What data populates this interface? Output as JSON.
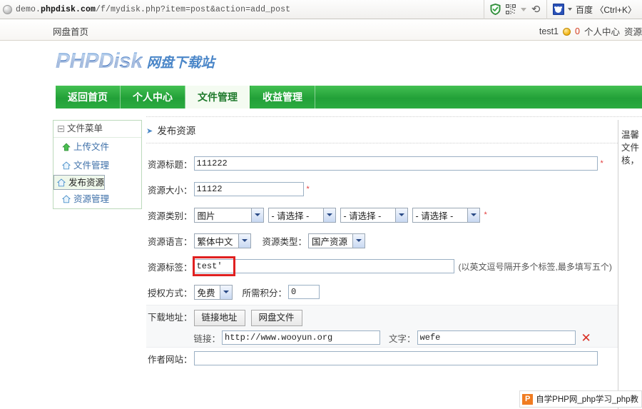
{
  "browser": {
    "url_prefix": "demo.",
    "url_bold": "phpdisk.com",
    "url_suffix": "/f/mydisk.php?item=post&action=add_post",
    "shield_icon": "shield-check-icon",
    "qr_icon": "qr-code-icon",
    "dropdown_icon": "chevron-down-icon",
    "reload_icon": "reload-icon",
    "search_engine_icon": "baidu-paw-icon",
    "search_label": "百度 〈Ctrl+K〉"
  },
  "topbar": {
    "home_link": "网盘首页",
    "username": "test1",
    "coin_icon": "coin-icon",
    "coin_count": "0",
    "user_center": "个人中心",
    "resource_link": "资源"
  },
  "logo": {
    "main": "PHPDisk",
    "sub": "网盘下载站"
  },
  "nav": {
    "items": [
      {
        "label": "返回首页",
        "active": false
      },
      {
        "label": "个人中心",
        "active": false
      },
      {
        "label": "文件管理",
        "active": true
      },
      {
        "label": "收益管理",
        "active": false
      }
    ]
  },
  "sidebar": {
    "header": "文件菜单",
    "collapse_icon": "minus-box-icon",
    "items": [
      {
        "label": "上传文件",
        "icon": "green-upload-arrow-icon",
        "selected": false
      },
      {
        "label": "文件管理",
        "icon": "blue-home-icon",
        "selected": false
      },
      {
        "label": "发布资源",
        "icon": "blue-home-icon",
        "selected": true
      },
      {
        "label": "资源管理",
        "icon": "blue-home-icon",
        "selected": false
      }
    ]
  },
  "content": {
    "title": "发布资源",
    "title_chevron": "chevron-right-icon",
    "fields": {
      "title_label": "资源标题：",
      "title_value": "111222",
      "size_label": "资源大小：",
      "size_value": "11122",
      "category_label": "资源类别：",
      "category_1": "图片",
      "category_2": "- 请选择 -",
      "category_3": "- 请选择 -",
      "category_4": "- 请选择 -",
      "language_label": "资源语言：",
      "language_value": "繁体中文",
      "restype_label": "资源类型：",
      "restype_value": "国产资源",
      "tags_label": "资源标签：",
      "tags_value": "test'",
      "tags_hint": "(以英文逗号隔开多个标签,最多填写五个)",
      "auth_label": "授权方式：",
      "auth_value": "免费",
      "credit_label": "所需积分：",
      "credit_value": "0",
      "download_label": "下载地址：",
      "btn_link": "链接地址",
      "btn_netdisk": "网盘文件",
      "link_label": "链接：",
      "link_value": "http://www.wooyun.org",
      "text_label": "文字：",
      "text_value": "wefe",
      "remove_icon": "remove-x-icon",
      "author_site_label": "作者网站：",
      "author_site_value": "",
      "required_mark": "*"
    }
  },
  "right_panel": {
    "lines": [
      "温馨",
      "文件",
      "核，"
    ]
  },
  "watermark": {
    "logo_letter": "P",
    "text": "自学PHP网_php学习_php教"
  },
  "colors": {
    "nav_green": "#22a038",
    "logo_blue": "#2e6fc4",
    "required_red": "#e23b3b",
    "highlight_red": "#e02020",
    "sidebar_link": "#3d6fa8"
  }
}
